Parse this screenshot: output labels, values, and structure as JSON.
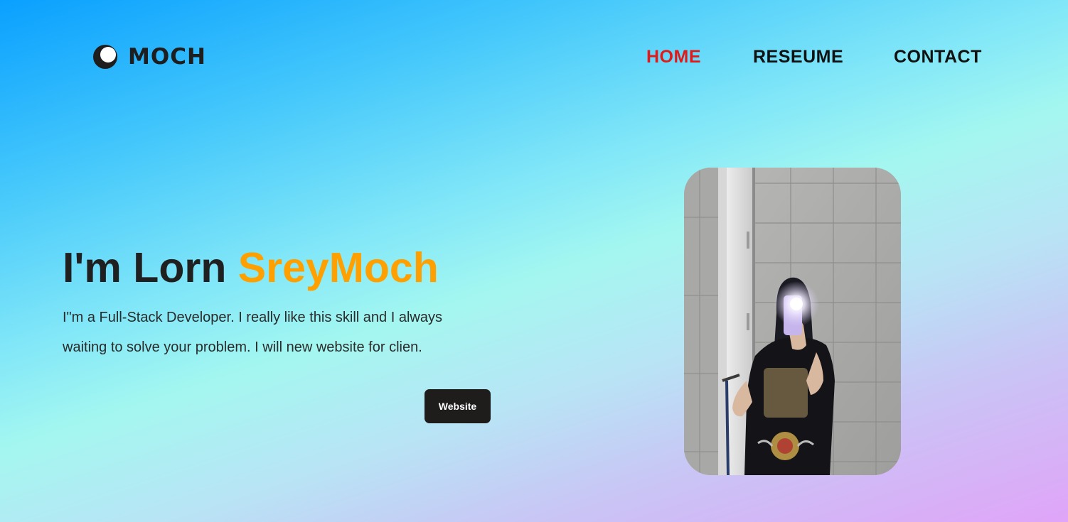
{
  "brand": {
    "name": "MOCH",
    "icon": "crescent-moon-icon"
  },
  "nav": {
    "home": "HOME",
    "resume": "RESEUME",
    "contact": "CONTACT",
    "active": "home",
    "active_color": "#e01a1a"
  },
  "hero": {
    "title_prefix": "I'm Lorn ",
    "title_highlight": "SreyMoch",
    "highlight_color": "#ffa000",
    "description": "I\"m a Full-Stack Developer. I really like this skill and I always waiting to solve your problem. I will new website for clien.",
    "button_label": "Website"
  },
  "photo": {
    "subject": "profile-photo"
  }
}
